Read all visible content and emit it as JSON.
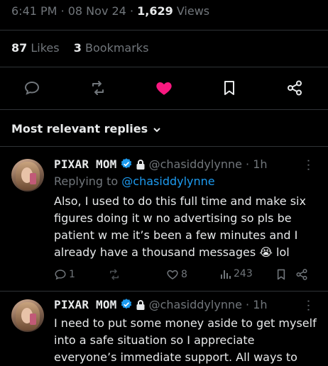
{
  "post": {
    "time": "6:41 PM",
    "date": "08 Nov 24",
    "views_count": "1,629",
    "views_label": "Views",
    "likes_count": "87",
    "likes_label": "Likes",
    "bookmarks_count": "3",
    "bookmarks_label": "Bookmarks",
    "liked": true,
    "like_color": "#f91880"
  },
  "replies_header": {
    "label": "Most relevant replies"
  },
  "replies": [
    {
      "name": "PIXAR MOM",
      "handle": "@chasiddylynne",
      "age": "1h",
      "replying_prefix": "Replying to",
      "replying_handle": "@chasiddylynne",
      "text": "Also, I used to do this full time and make six figures doing it w no advertising so pls be patient w me it’s been a few minutes and I already have a thousand messages 😭 lol",
      "reply_count": "1",
      "like_count": "8",
      "view_count": "243"
    },
    {
      "name": "PIXAR MOM",
      "handle": "@chasiddylynne",
      "age": "1h",
      "text": "I need to put some money aside to get myself into a safe situation so I appreciate everyone’s immediate support. All ways to"
    }
  ],
  "colors": {
    "accent": "#1d9bf0",
    "muted": "#71767b",
    "text": "#e7e9ea",
    "verified": "#1d9bf0"
  },
  "icons": [
    "reply-icon",
    "retweet-icon",
    "heart-icon",
    "bookmark-icon",
    "share-icon",
    "verified-icon",
    "lock-icon",
    "chevron-down-icon",
    "more-icon",
    "views-icon"
  ]
}
